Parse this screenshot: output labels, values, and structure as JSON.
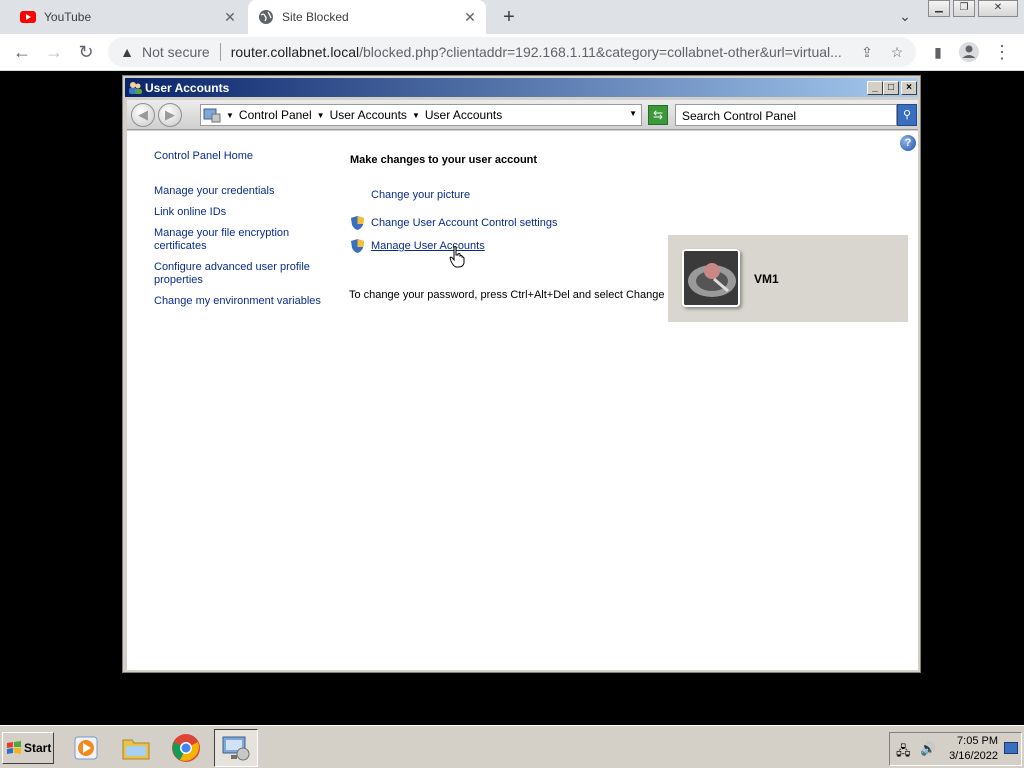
{
  "browser": {
    "tabs": [
      {
        "title": "YouTube",
        "icon": "youtube-icon"
      },
      {
        "title": "Site Blocked",
        "icon": "globe-icon"
      }
    ],
    "not_secure_label": "Not secure",
    "url_host": "router.collabnet.local",
    "url_path": "/blocked.php?clientaddr=192.168.1.11&category=collabnet-other&url=virtual..."
  },
  "window": {
    "title": "User Accounts",
    "breadcrumb": [
      "Control Panel",
      "User Accounts",
      "User Accounts"
    ],
    "search_placeholder": "Search Control Panel"
  },
  "sidebar": {
    "home": "Control Panel Home",
    "links": [
      "Manage your credentials",
      "Link online IDs",
      "Manage your file encryption certificates",
      "Configure advanced user profile properties",
      "Change my environment variables"
    ]
  },
  "main": {
    "heading": "Make changes to your user account",
    "tasks": [
      "Change your picture",
      "Change User Account Control settings",
      "Manage User Accounts"
    ],
    "info": "To change your password, press Ctrl+Alt+Del and select Change a password.",
    "username": "VM1"
  },
  "taskbar": {
    "start_label": "Start",
    "time": "7:05 PM",
    "date": "3/16/2022"
  }
}
